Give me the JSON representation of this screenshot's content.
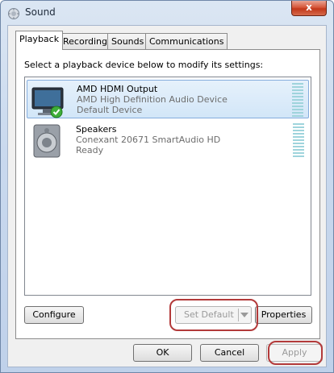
{
  "window": {
    "title": "Sound",
    "close_label": "x"
  },
  "tabs": [
    {
      "label": "Playback"
    },
    {
      "label": "Recording"
    },
    {
      "label": "Sounds"
    },
    {
      "label": "Communications"
    }
  ],
  "playback": {
    "instruction": "Select a playback device below to modify its settings:",
    "devices": [
      {
        "name": "AMD HDMI Output",
        "description": "AMD High Definition Audio Device",
        "status": "Default Device",
        "icon": "monitor-icon",
        "selected": true
      },
      {
        "name": "Speakers",
        "description": "Conexant 20671 SmartAudio HD",
        "status": "Ready",
        "icon": "speaker-icon",
        "selected": false
      }
    ]
  },
  "buttons": {
    "configure": "Configure",
    "set_default": "Set Default",
    "properties": "Properties",
    "ok": "OK",
    "cancel": "Cancel",
    "apply": "Apply"
  }
}
